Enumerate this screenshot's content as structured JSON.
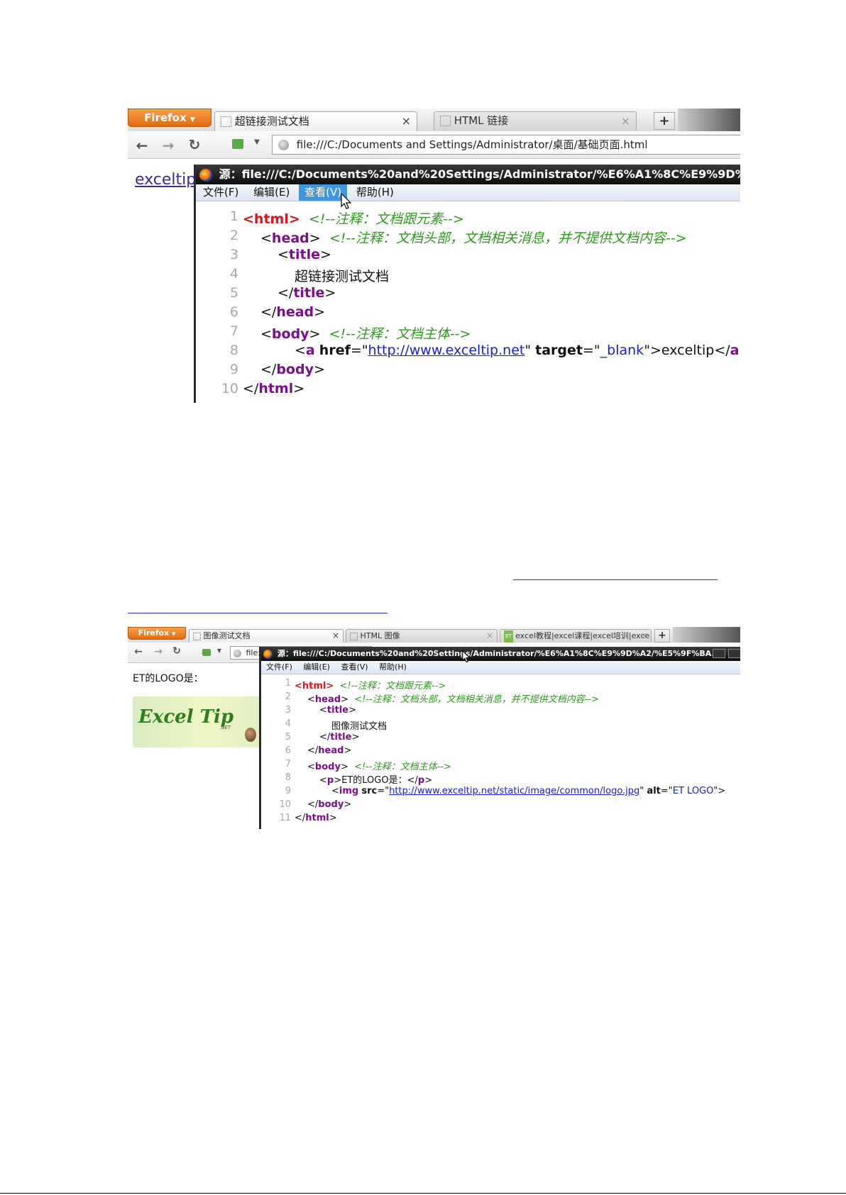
{
  "shot1": {
    "firefox_label": "Firefox",
    "tabs": [
      {
        "label": "超链接测试文档",
        "close": "×"
      },
      {
        "label": "HTML 链接",
        "close": "×"
      }
    ],
    "new_tab": "+",
    "nav_icons": [
      "back-arrow-icon",
      "forward-arrow-icon",
      "reload-icon",
      "home-icon",
      "dropdown-icon",
      "globe-icon"
    ],
    "url": "file:///C:/Documents and Settings/Administrator/桌面/基础页面.html",
    "page_link": "exceltip",
    "source_window": {
      "title": "源：file:///C:/Documents%20and%20Settings/Administrator/%E6%A1%8C%E9%9D%A2/%",
      "menu": [
        "文件(F)",
        "编辑(E)",
        "查看(V)",
        "帮助(H)"
      ],
      "highlighted_menu": "查看(V)"
    },
    "code": {
      "line_numbers": [
        "1",
        "2",
        "3",
        "4",
        "5",
        "6",
        "7",
        "8",
        "9",
        "10"
      ],
      "l1_tag": "<html>",
      "l1_comment": "<!--注释：文档跟元素-->",
      "l2_open": "<",
      "l2_tag": "head",
      "l2_close": ">",
      "l2_comment": "<!--注释：文档头部，文档相关消息，并不提供文档内容-->",
      "l3_open": "<",
      "l3_tag": "title",
      "l3_close": ">",
      "l4_text": "超链接测试文档",
      "l5_open": "</",
      "l5_tag": "title",
      "l5_close": ">",
      "l6_open": "</",
      "l6_tag": "head",
      "l6_close": ">",
      "l7_open": "<",
      "l7_tag": "body",
      "l7_close": ">",
      "l7_comment": "<!--注释：文档主体-->",
      "l8_open": "<",
      "l8_tag": "a",
      "l8_attr1": "href",
      "l8_eq1": "=\"",
      "l8_val1": "http://www.exceltip.net",
      "l8_q1": "\"",
      "l8_attr2": "target",
      "l8_eq2": "=\"",
      "l8_val2": "_blank",
      "l8_q2": "\"",
      "l8_gt": ">",
      "l8_text": "exceltip",
      "l8_endopen": "</",
      "l8_endtag": "a",
      "l8_end": ">",
      "l9_open": "</",
      "l9_tag": "body",
      "l9_close": ">",
      "l10_open": "</",
      "l10_tag": "html",
      "l10_close": ">"
    }
  },
  "shot2": {
    "firefox_label": "Firefox",
    "tabs": [
      {
        "label": "图像测试文档",
        "close": "×"
      },
      {
        "label": "HTML 图像",
        "close": "×"
      },
      {
        "label": "excel教程|excel课程|excel培训|exce...",
        "close": "×",
        "badge": "ET"
      }
    ],
    "new_tab": "+",
    "url_fragment": "file:",
    "page_text": "ET的LOGO是：",
    "logo_text": "Excel Tip",
    "logo_sub": ".NET",
    "source_window": {
      "title": "源：file:///C:/Documents%20and%20Settings/Administrator/%E6%A1%8C%E9%9D%A2/%E5%9F%BA...",
      "menu": [
        "文件(F)",
        "编辑(E)",
        "查看(V)",
        "帮助(H)"
      ]
    },
    "code": {
      "line_numbers": [
        "1",
        "2",
        "3",
        "4",
        "5",
        "6",
        "7",
        "8",
        "9",
        "10",
        "11"
      ],
      "l1_tag": "<html>",
      "l1_comment": "<!--注释：文档跟元素-->",
      "l2_open": "<",
      "l2_tag": "head",
      "l2_close": ">",
      "l2_comment": "<!--注释：文档头部，文档相关消息，并不提供文档内容-->",
      "l3_open": "<",
      "l3_tag": "title",
      "l3_close": ">",
      "l4_text": "图像测试文档",
      "l5_open": "</",
      "l5_tag": "title",
      "l5_close": ">",
      "l6_open": "</",
      "l6_tag": "head",
      "l6_close": ">",
      "l7_open": "<",
      "l7_tag": "body",
      "l7_close": ">",
      "l7_comment": "<!--注释：文档主体-->",
      "l8_open": "<",
      "l8_tag": "p",
      "l8_gt": ">",
      "l8_text": "ET的LOGO是：",
      "l8_endopen": "</",
      "l8_endtag": "p",
      "l8_end": ">",
      "l9_open": "<",
      "l9_tag": "img",
      "l9_attr1": "src",
      "l9_eq1": "=\"",
      "l9_val1": "http://www.exceltip.net/static/image/common/logo.jpg",
      "l9_q1": "\"",
      "l9_attr2": "alt",
      "l9_eq2": "=\"",
      "l9_val2": "ET LOGO",
      "l9_q2": "\"",
      "l9_gt": ">",
      "l10_open": "</",
      "l10_tag": "body",
      "l10_close": ">",
      "l11_open": "</",
      "l11_tag": "html",
      "l11_close": ">"
    }
  },
  "colors": {
    "tag_red": "#d8171b",
    "tag_purple": "#7a0e8c",
    "comment_green": "#2e9a1e",
    "link_blue": "#1620d6",
    "menu_highlight": "#3d97e0"
  }
}
